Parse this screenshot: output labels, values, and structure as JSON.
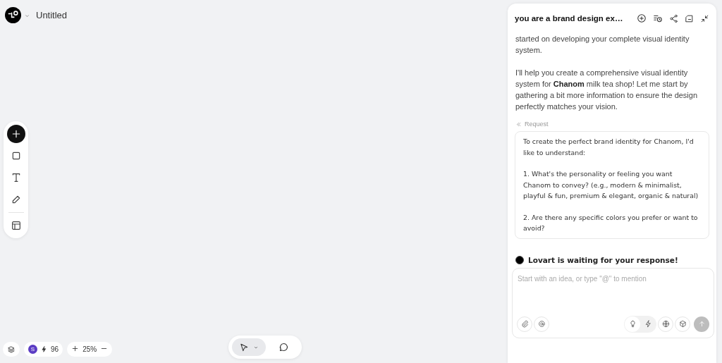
{
  "header": {
    "title": "Untitled"
  },
  "tools": [
    {
      "kind": "add"
    },
    {
      "kind": "rect"
    },
    {
      "kind": "text"
    },
    {
      "kind": "pen"
    },
    {
      "kind": "divider"
    },
    {
      "kind": "layout"
    }
  ],
  "status": {
    "avatar": "S",
    "credits": "96",
    "zoom": "25%"
  },
  "modes": [
    {
      "kind": "pointer",
      "selected": true
    },
    {
      "kind": "comment",
      "selected": false
    }
  ],
  "chat": {
    "title": "you are a brand design ex…",
    "messages": [
      "started on developing your complete visual identity system.",
      "I'll help you create a comprehensive visual identity system for **Chanom** milk tea shop! Let me start by gathering a bit more information to ensure the design perfectly matches your vision."
    ],
    "request_label": "Request",
    "request": [
      "To create the perfect brand identity for Chanom, I'd like to understand:",
      "1. What's the personality or feeling you want Chanom to convey? (e.g., modern & minimalist, playful & fun, premium & elegant, organic & natural)",
      "2. Are there any specific colors you prefer or want to avoid?"
    ],
    "waiting": "Lovart is waiting for your response!",
    "input": {
      "placeholder": "Start with an idea, or type \"@\" to mention"
    },
    "modes": [
      {
        "kind": "idea",
        "selected": true
      },
      {
        "kind": "fast",
        "selected": false
      }
    ]
  }
}
